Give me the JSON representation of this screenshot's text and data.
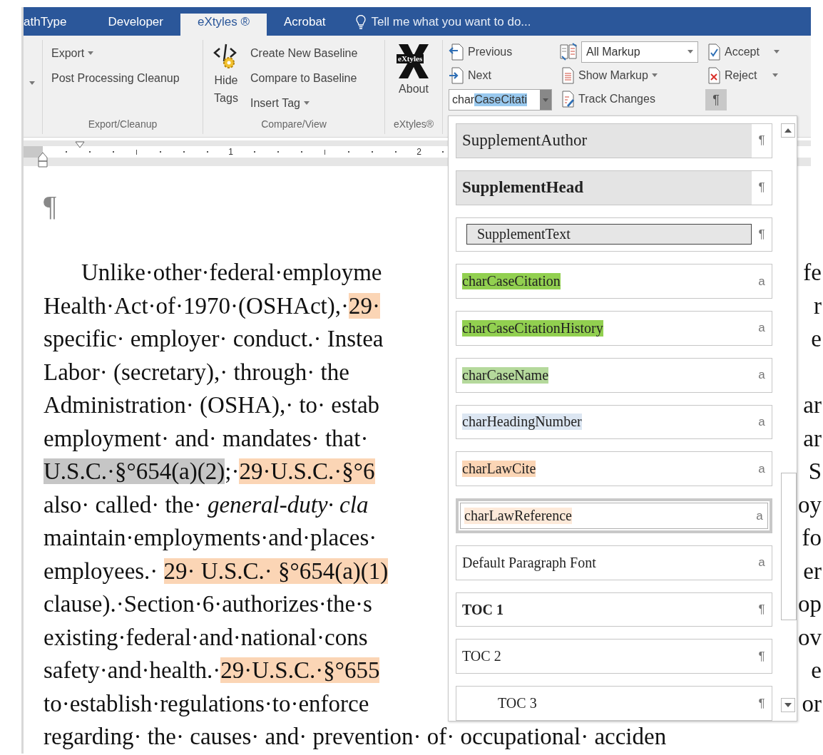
{
  "tabs": [
    {
      "label": "athType",
      "selected": false
    },
    {
      "label": "Developer",
      "selected": false
    },
    {
      "label": "eXtyles ®",
      "selected": true
    },
    {
      "label": "Acrobat",
      "selected": false
    }
  ],
  "tell_me": {
    "text": "Tell me what you want to do..."
  },
  "ribbon": {
    "export_cleanup": {
      "label": "Export/Cleanup",
      "buttons": [
        {
          "label": "Export",
          "dropdown": true
        },
        {
          "label": "Post Processing Cleanup",
          "dropdown": false
        }
      ]
    },
    "compare_view": {
      "label": "Compare/View",
      "big_button": "Hide Tags",
      "buttons": [
        {
          "label": "Create New Baseline",
          "dropdown": false
        },
        {
          "label": "Compare to Baseline",
          "dropdown": false
        },
        {
          "label": "Insert Tag",
          "dropdown": true
        }
      ]
    },
    "extyles": {
      "label": "eXtyles®",
      "logo_text": "eXtyles",
      "button": "About"
    },
    "review": {
      "previous": "Previous",
      "next": "Next",
      "style_box": {
        "prefix": "char",
        "selected_text": "CaseCitati"
      },
      "markup_box": {
        "value": "All Markup"
      },
      "show_markup": "Show Markup",
      "track_changes": "Track Changes",
      "accept": "Accept",
      "reject": "Reject",
      "formatting_marks": {
        "label": "¶",
        "pressed": true
      }
    }
  },
  "ruler": {
    "numbers": [
      "1",
      "2"
    ]
  },
  "document": {
    "pilcrow": "¶",
    "lines": [
      {
        "indent": true,
        "segments": [
          {
            "kind": "plain",
            "text": "Unlike·other·federal·employme"
          }
        ],
        "right": "fe"
      },
      {
        "indent": false,
        "segments": [
          {
            "kind": "plain",
            "text": "Health·Act·of·1970·(OSHAct),·"
          },
          {
            "kind": "citation",
            "text": "29·"
          }
        ],
        "right": "r"
      },
      {
        "indent": false,
        "segments": [
          {
            "kind": "plain",
            "text": "specific· employer· conduct.· Instea"
          }
        ],
        "right": "e"
      },
      {
        "indent": false,
        "segments": [
          {
            "kind": "plain",
            "text": "Labor· (secretary),· through· the"
          }
        ]
      },
      {
        "indent": false,
        "segments": [
          {
            "kind": "plain",
            "text": "Administration· (OSHA),· to· estab"
          }
        ],
        "right": "ar"
      },
      {
        "indent": false,
        "segments": [
          {
            "kind": "plain",
            "text": "employment· and· mandates· that·"
          }
        ],
        "right": "ar"
      },
      {
        "indent": false,
        "segments": [
          {
            "kind": "selection",
            "text": "U.S.C.·§°654(a)(2)"
          },
          {
            "kind": "plain",
            "text": ";·"
          },
          {
            "kind": "citation",
            "text": "29·U.S.C.·§°6"
          }
        ],
        "right": "S"
      },
      {
        "indent": false,
        "segments": [
          {
            "kind": "plain",
            "text": "also· called· the· "
          },
          {
            "kind": "italic",
            "text": "general-duty· cla"
          }
        ],
        "right": "oy"
      },
      {
        "indent": false,
        "segments": [
          {
            "kind": "plain",
            "text": "maintain·employments·and·places·"
          }
        ],
        "right": "fo"
      },
      {
        "indent": false,
        "segments": [
          {
            "kind": "plain",
            "text": "employees.· "
          },
          {
            "kind": "citation",
            "text": "29· U.S.C.· §°654(a)(1)"
          }
        ],
        "right": "er"
      },
      {
        "indent": false,
        "segments": [
          {
            "kind": "plain",
            "text": "clause).·Section·6·authorizes·the·s"
          }
        ],
        "right": "op"
      },
      {
        "indent": false,
        "segments": [
          {
            "kind": "plain",
            "text": "existing·federal·and·national·cons"
          }
        ],
        "right": "ov"
      },
      {
        "indent": false,
        "segments": [
          {
            "kind": "plain",
            "text": "safety·and·health.·"
          },
          {
            "kind": "citation",
            "text": "29·U.S.C.·§°655"
          }
        ],
        "right": "e"
      },
      {
        "indent": false,
        "segments": [
          {
            "kind": "plain",
            "text": "to·establish·regulations·to·enforce"
          }
        ],
        "right": "or"
      },
      {
        "indent": false,
        "segments": [
          {
            "kind": "plain",
            "text": "regarding· the· causes· and· prevention· of· occupational· acciden"
          }
        ]
      }
    ]
  },
  "style_gallery": {
    "items": [
      {
        "name": "SupplementAuthor",
        "kind": "heading",
        "mark": "¶",
        "selected": false
      },
      {
        "name": "SupplementHead",
        "kind": "heading-bold",
        "mark": "¶",
        "selected": false
      },
      {
        "name": "SupplementText",
        "kind": "boxed",
        "mark": "¶",
        "selected": false
      },
      {
        "name": "charCaseCitation",
        "kind": "char",
        "color": "#92d050",
        "mark": "a",
        "selected": false
      },
      {
        "name": "charCaseCitationHistory",
        "kind": "char",
        "color": "#92d050",
        "mark": "a",
        "selected": false
      },
      {
        "name": "charCaseName",
        "kind": "char",
        "color": "#b5d99c",
        "mark": "a",
        "selected": false
      },
      {
        "name": "charHeadingNumber",
        "kind": "char",
        "color": "#dce6f2",
        "mark": "a",
        "selected": false
      },
      {
        "name": "charLawCite",
        "kind": "char",
        "color": "#fbd5b5",
        "mark": "a",
        "selected": false
      },
      {
        "name": "charLawReference",
        "kind": "char",
        "color": "#fde9d9",
        "mark": "a",
        "selected": true
      },
      {
        "name": "Default Paragraph Font",
        "kind": "plain",
        "mark": "a",
        "selected": false
      },
      {
        "name": "TOC 1",
        "kind": "toc1",
        "mark": "¶",
        "selected": false
      },
      {
        "name": "TOC 2",
        "kind": "toc2",
        "mark": "¶",
        "selected": false
      },
      {
        "name": "TOC 3",
        "kind": "toc3",
        "mark": "¶",
        "selected": false
      }
    ]
  }
}
